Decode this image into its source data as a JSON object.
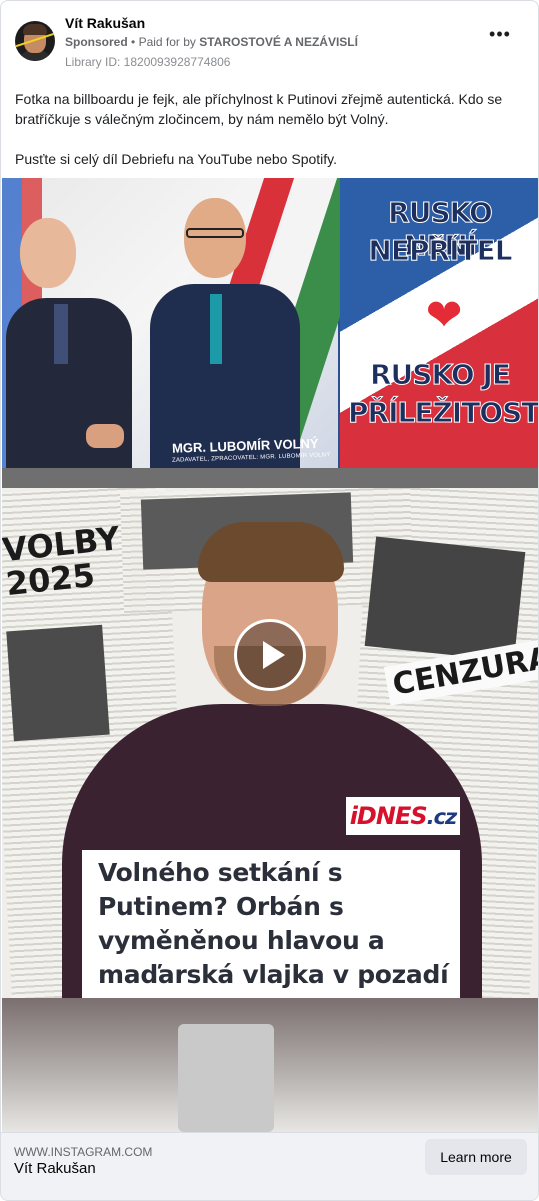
{
  "post": {
    "author": "Vít Rakušan",
    "sponsored": "Sponsored",
    "paid_for_prefix": "Paid for by",
    "payer": "STAROSTOVÉ A NEZÁVISLÍ",
    "library_id": "Library ID: 1820093928774806",
    "more_icon": "more-options-icon",
    "text_lines": [
      "Fotka na billboardu je fejk, ale příchylnost k Putinovi zřejmě autentická. Kdo se bratříčkuje s válečným zločincem, by nám nemělo být Volný.",
      "Pusťte si celý díl Debriefu na YouTube nebo Spotify."
    ]
  },
  "media": {
    "billboard": {
      "name": "MGR. LUBOMÍR VOLNÝ",
      "sub": "ZADAVATEL, ZPRACOVATEL: MGR. LUBOMÍR VOLNÝ",
      "slogan_top_1": "RUSKO NENÍ",
      "slogan_top_2": "NEPŘÍTEL",
      "heart": "❤",
      "slogan_bottom_1": "RUSKO JE",
      "slogan_bottom_2": "PŘÍLEŽITOST"
    },
    "newspaper": {
      "volby": "VOLBY 2025",
      "cenzura": "CENZURA?"
    },
    "play_icon": "play-icon",
    "logo_red": "iDNES",
    "logo_blue": ".cz",
    "headline_lines": [
      "Volného setkání s",
      "Putinem? Orbán s",
      "vyměněnou hlavou a",
      "maďarská vlajka v pozadí"
    ]
  },
  "footer": {
    "domain": "WWW.INSTAGRAM.COM",
    "title": "Vít Rakušan",
    "cta": "Learn more"
  },
  "colors": {
    "accent_red": "#d7112b",
    "accent_blue": "#1d3b82",
    "heart": "#e42b36"
  }
}
